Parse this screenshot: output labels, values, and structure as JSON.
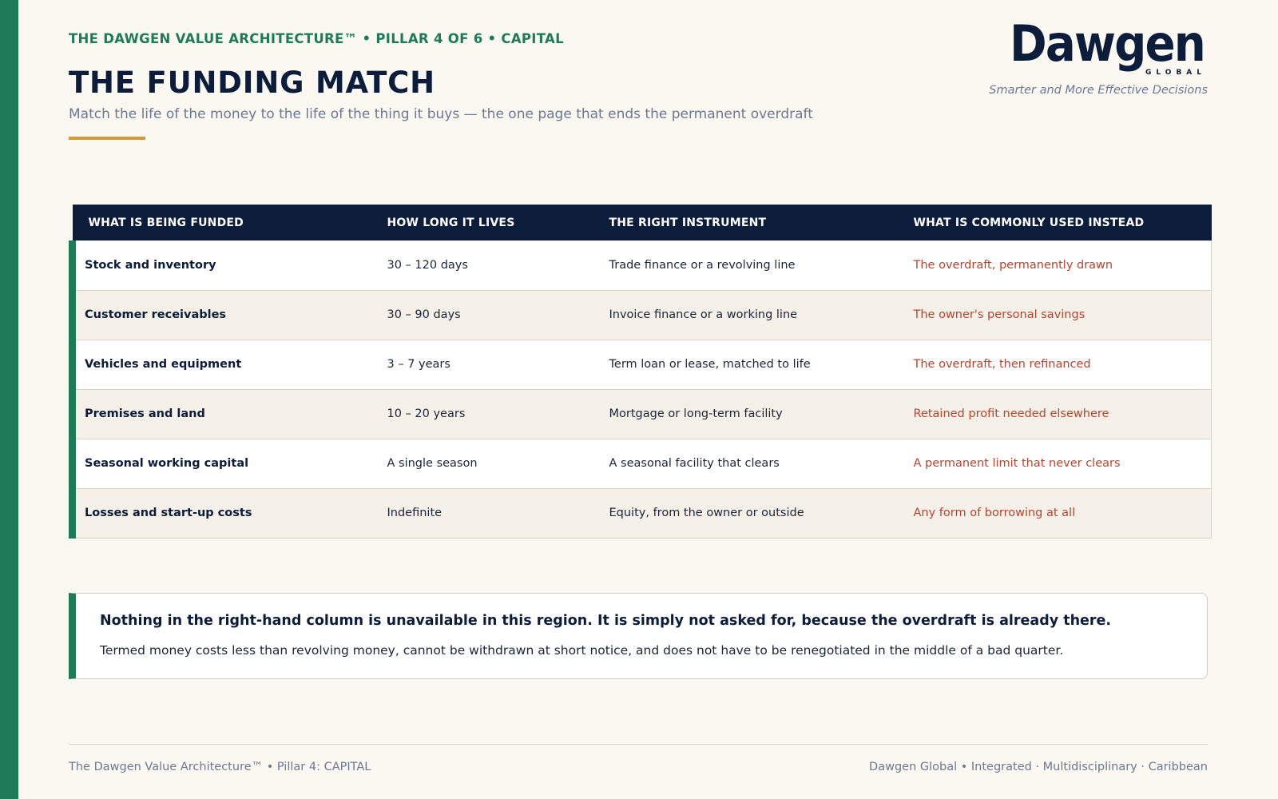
{
  "header": {
    "eyebrow": "THE DAWGEN VALUE ARCHITECTURE™  •  PILLAR 4 OF 6  •  CAPITAL",
    "title": "THE FUNDING MATCH",
    "subtitle": "Match the life of the money to the life of the thing it buys — the one page that ends the permanent overdraft"
  },
  "brand": {
    "logo_text": "Dawgen",
    "logo_subtext": "GLOBAL",
    "tagline": "Smarter and More Effective Decisions",
    "colors": {
      "navy": "#0B1D3A",
      "green": "#1E7B57",
      "gold": "#D49A3A",
      "red": "#B8442E"
    }
  },
  "table": {
    "columns": [
      "WHAT IS BEING FUNDED",
      "HOW LONG IT LIVES",
      "THE RIGHT INSTRUMENT",
      "WHAT IS COMMONLY USED INSTEAD"
    ],
    "rows": [
      [
        "Stock and inventory",
        "30 – 120 days",
        "Trade finance or a revolving line",
        "The overdraft, permanently drawn"
      ],
      [
        "Customer receivables",
        "30 – 90 days",
        "Invoice finance or a working line",
        "The owner's personal savings"
      ],
      [
        "Vehicles and equipment",
        "3 – 7 years",
        "Term loan or lease, matched to life",
        "The overdraft, then refinanced"
      ],
      [
        "Premises and land",
        "10 – 20 years",
        "Mortgage or long-term facility",
        "Retained profit needed elsewhere"
      ],
      [
        "Seasonal working capital",
        "A single season",
        "A seasonal facility that clears",
        "A permanent limit that never clears"
      ],
      [
        "Losses and start-up costs",
        "Indefinite",
        "Equity, from the owner or outside",
        "Any form of borrowing at all"
      ]
    ]
  },
  "callout": {
    "headline": "Nothing in the right-hand column is unavailable in this region. It is simply not asked for, because the overdraft is already there.",
    "body": "Termed money costs less than revolving money, cannot be withdrawn at short notice, and does not have to be renegotiated in the middle of a bad quarter."
  },
  "footer": {
    "left": "The Dawgen Value Architecture™  •  Pillar 4: CAPITAL",
    "right": "Dawgen Global  •  Integrated · Multidisciplinary · Caribbean"
  }
}
